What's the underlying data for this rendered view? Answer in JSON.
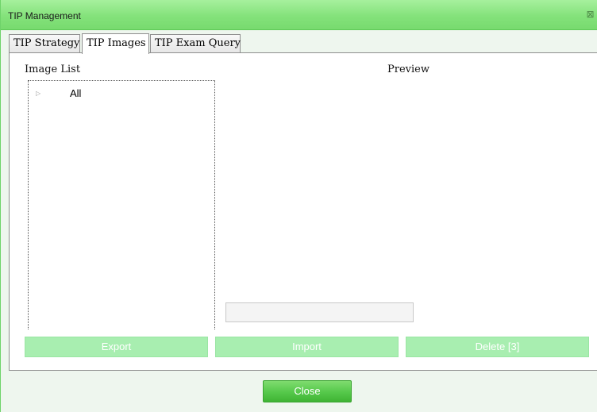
{
  "window": {
    "title": "TIP Management",
    "close_symbol": "⊠"
  },
  "tabs": [
    {
      "label": "TIP Strategy",
      "active": false
    },
    {
      "label": "TIP Images",
      "active": true
    },
    {
      "label": "TIP Exam Query",
      "active": false
    }
  ],
  "image_list": {
    "heading": "Image List",
    "tree": [
      {
        "label": "All",
        "expand_icon": "triangle-right-icon"
      }
    ]
  },
  "preview": {
    "heading": "Preview",
    "path_value": ""
  },
  "actions": {
    "export_label": "Export",
    "import_label": "Import",
    "delete_label": "Delete [3]"
  },
  "footer": {
    "close_label": "Close"
  },
  "colors": {
    "title_bar": "#84e27b",
    "disabled_button": "#a8eeb0",
    "close_button": "#55c84a",
    "window_bg": "#eef6ee"
  }
}
